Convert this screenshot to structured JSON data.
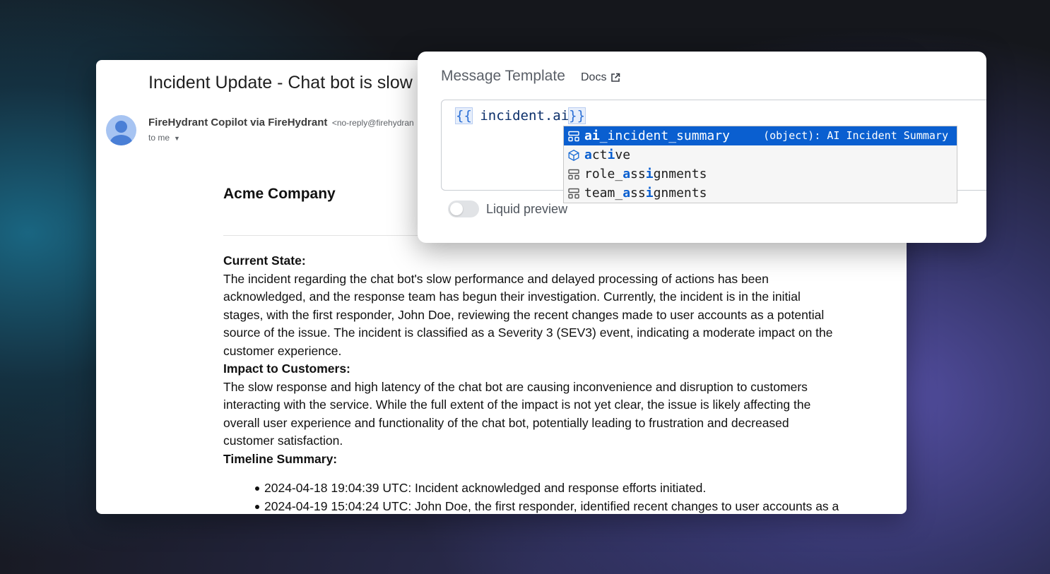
{
  "email": {
    "subject": "Incident Update - Chat bot is slow an",
    "sender_name": "FireHydrant Copilot via FireHydrant",
    "sender_email": "<no-reply@firehydran",
    "to": "to me",
    "company": "Acme Company",
    "sections": [
      {
        "heading": "Current State:",
        "text": "The incident regarding the chat bot's slow performance and delayed processing of actions has been acknowledged, and the response team has begun their investigation. Currently, the incident is in the initial stages, with the first responder, John Doe, reviewing the recent changes made to user accounts as a potential source of the issue. The incident is classified as a Severity 3 (SEV3) event, indicating a moderate impact on the customer experience."
      },
      {
        "heading": "Impact to Customers:",
        "text": "The slow response and high latency of the chat bot are causing inconvenience and disruption to customers interacting with the service. While the full extent of the impact is not yet clear, the issue is likely affecting the overall user experience and functionality of the chat bot, potentially leading to frustration and decreased customer satisfaction."
      }
    ],
    "timeline_heading": "Timeline Summary:",
    "timeline": [
      "2024-04-18 19:04:39 UTC: Incident acknowledged and response efforts initiated.",
      "2024-04-19 15:04:24 UTC: John Doe, the first responder, identified recent changes to user accounts as a"
    ]
  },
  "template": {
    "title": "Message Template",
    "docs_label": "Docs",
    "code": {
      "open": "{{",
      "text": " incident.ai",
      "close": "}}"
    },
    "autocomplete": [
      {
        "icon": "object-icon",
        "label": "ai_incident_summary",
        "detail": "(object): AI Incident Summary",
        "selected": true
      },
      {
        "icon": "cube-icon",
        "label": "active",
        "selected": false
      },
      {
        "icon": "object-icon",
        "label": "role_assignments",
        "selected": false
      },
      {
        "icon": "object-icon",
        "label": "team_assignments",
        "selected": false
      }
    ],
    "toggle_label": "Liquid preview",
    "toggle_on": false
  },
  "colors": {
    "selected_bg": "#0a5fd0",
    "match_highlight": "#0a5fd0"
  }
}
